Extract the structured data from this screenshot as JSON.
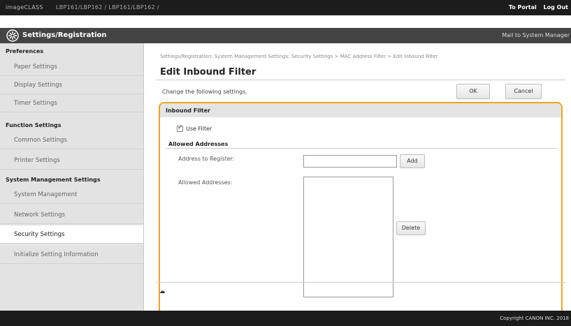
{
  "topbar": {
    "brand": "imageCLASS",
    "crumbs": "LBP161/LBP162 / LBP161/LBP162 /",
    "portal": "To Portal",
    "logout": "Log Out"
  },
  "titlebar": {
    "title": "Settings/Registration",
    "mail": "Mail to System Manager",
    "icon": "settings-gear-icon"
  },
  "sidebar": {
    "sections": [
      {
        "title": "Preferences",
        "items": [
          "Paper Settings",
          "Display Settings",
          "Timer Settings"
        ]
      },
      {
        "title": "Function Settings",
        "items": [
          "Common Settings",
          "Printer Settings"
        ]
      },
      {
        "title": "System Management Settings",
        "items": [
          "System Management",
          "Network Settings",
          "Security Settings",
          "Initialize Setting Information"
        ]
      }
    ],
    "active": "Security Settings"
  },
  "main": {
    "breadcrumb": "Settings/Registration: System Management Settings: Security Settings > MAC Address Filter > Edit Inbound Filter",
    "title": "Edit Inbound Filter",
    "change_text": "Change the following settings.",
    "ok_label": "OK",
    "cancel_label": "Cancel",
    "to_top": "⯊"
  },
  "filter": {
    "header": "Inbound Filter",
    "use_filter_label": "Use Filter",
    "use_filter_checked": true,
    "allowed_header": "Allowed Addresses",
    "address_label": "Address to Register:",
    "address_value": "",
    "add_label": "Add",
    "allowed_label": "Allowed Addresses:",
    "delete_label": "Delete"
  },
  "footer": {
    "copyright": "Copyright CANON INC. 2018"
  },
  "colors": {
    "highlight": "#f2a21c",
    "topbar": "#1c1c1c",
    "titlebar": "#444444",
    "sidebar": "#e3e3e3"
  }
}
